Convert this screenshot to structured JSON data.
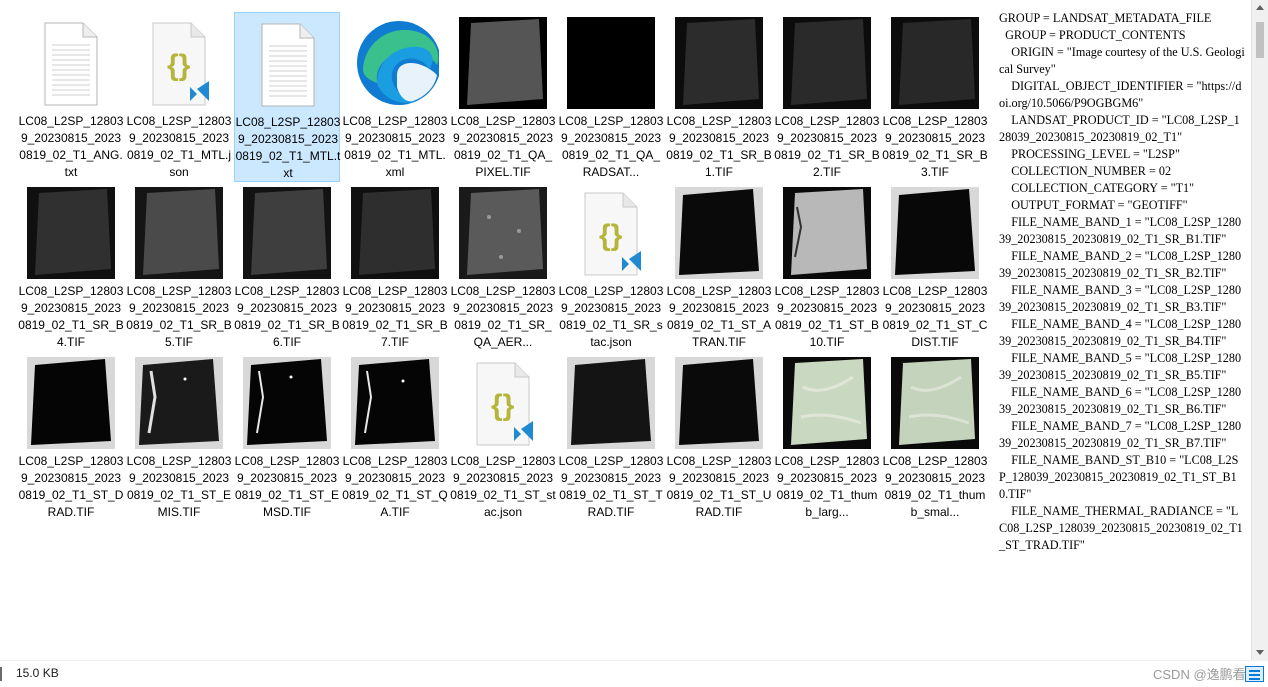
{
  "files": [
    {
      "name": "LC08_L2SP_128039_20230815_20230819_02_T1_ANG.txt",
      "icon": "text-document-icon",
      "selected": false
    },
    {
      "name": "LC08_L2SP_128039_20230815_20230819_02_T1_MTL.json",
      "icon": "json-vscode-icon",
      "selected": false
    },
    {
      "name": "LC08_L2SP_128039_20230815_20230819_02_T1_MTL.txt",
      "icon": "text-document-icon",
      "selected": true
    },
    {
      "name": "LC08_L2SP_128039_20230815_20230819_02_T1_MTL.xml",
      "icon": "edge-browser-icon",
      "selected": false
    },
    {
      "name": "LC08_L2SP_128039_20230815_20230819_02_T1_QA_PIXEL.TIF",
      "icon": "tif-thumbnail-icon",
      "selected": false
    },
    {
      "name": "LC08_L2SP_128039_20230815_20230819_02_T1_QA_RADSAT...",
      "icon": "tif-thumbnail-icon",
      "selected": false
    },
    {
      "name": "LC08_L2SP_128039_20230815_20230819_02_T1_SR_B1.TIF",
      "icon": "tif-thumbnail-icon",
      "selected": false
    },
    {
      "name": "LC08_L2SP_128039_20230815_20230819_02_T1_SR_B2.TIF",
      "icon": "tif-thumbnail-icon",
      "selected": false
    },
    {
      "name": "LC08_L2SP_128039_20230815_20230819_02_T1_SR_B3.TIF",
      "icon": "tif-thumbnail-icon",
      "selected": false
    },
    {
      "name": "LC08_L2SP_128039_20230815_20230819_02_T1_SR_B4.TIF",
      "icon": "tif-thumbnail-icon",
      "selected": false
    },
    {
      "name": "LC08_L2SP_128039_20230815_20230819_02_T1_SR_B5.TIF",
      "icon": "tif-thumbnail-icon",
      "selected": false
    },
    {
      "name": "LC08_L2SP_128039_20230815_20230819_02_T1_SR_B6.TIF",
      "icon": "tif-thumbnail-icon",
      "selected": false
    },
    {
      "name": "LC08_L2SP_128039_20230815_20230819_02_T1_SR_B7.TIF",
      "icon": "tif-thumbnail-icon",
      "selected": false
    },
    {
      "name": "LC08_L2SP_128039_20230815_20230819_02_T1_SR_QA_AER...",
      "icon": "tif-thumbnail-icon",
      "selected": false
    },
    {
      "name": "LC08_L2SP_128039_20230815_20230819_02_T1_SR_stac.json",
      "icon": "json-vscode-icon",
      "selected": false
    },
    {
      "name": "LC08_L2SP_128039_20230815_20230819_02_T1_ST_ATRAN.TIF",
      "icon": "tif-thumbnail-icon",
      "selected": false
    },
    {
      "name": "LC08_L2SP_128039_20230815_20230819_02_T1_ST_B10.TIF",
      "icon": "tif-thumbnail-icon",
      "selected": false
    },
    {
      "name": "LC08_L2SP_128039_20230815_20230819_02_T1_ST_CDIST.TIF",
      "icon": "tif-thumbnail-icon",
      "selected": false
    },
    {
      "name": "LC08_L2SP_128039_20230815_20230819_02_T1_ST_DRAD.TIF",
      "icon": "tif-thumbnail-icon",
      "selected": false
    },
    {
      "name": "LC08_L2SP_128039_20230815_20230819_02_T1_ST_EMIS.TIF",
      "icon": "tif-thumbnail-icon",
      "selected": false
    },
    {
      "name": "LC08_L2SP_128039_20230815_20230819_02_T1_ST_EMSD.TIF",
      "icon": "tif-thumbnail-icon",
      "selected": false
    },
    {
      "name": "LC08_L2SP_128039_20230815_20230819_02_T1_ST_QA.TIF",
      "icon": "tif-thumbnail-icon",
      "selected": false
    },
    {
      "name": "LC08_L2SP_128039_20230815_20230819_02_T1_ST_stac.json",
      "icon": "json-vscode-icon",
      "selected": false
    },
    {
      "name": "LC08_L2SP_128039_20230815_20230819_02_T1_ST_TRAD.TIF",
      "icon": "tif-thumbnail-icon",
      "selected": false
    },
    {
      "name": "LC08_L2SP_128039_20230815_20230819_02_T1_ST_URAD.TIF",
      "icon": "tif-thumbnail-icon",
      "selected": false
    },
    {
      "name": "LC08_L2SP_128039_20230815_20230819_02_T1_thumb_larg...",
      "icon": "jpeg-thumbnail-icon",
      "selected": false
    },
    {
      "name": "LC08_L2SP_128039_20230815_20230819_02_T1_thumb_smal...",
      "icon": "jpeg-thumbnail-icon",
      "selected": false
    }
  ],
  "preview_text": "GROUP = LANDSAT_METADATA_FILE\n  GROUP = PRODUCT_CONTENTS\n    ORIGIN = \"Image courtesy of the U.S. Geological Survey\"\n    DIGITAL_OBJECT_IDENTIFIER = \"https://doi.org/10.5066/P9OGBGM6\"\n    LANDSAT_PRODUCT_ID = \"LC08_L2SP_128039_20230815_20230819_02_T1\"\n    PROCESSING_LEVEL = \"L2SP\"\n    COLLECTION_NUMBER = 02\n    COLLECTION_CATEGORY = \"T1\"\n    OUTPUT_FORMAT = \"GEOTIFF\"\n    FILE_NAME_BAND_1 = \"LC08_L2SP_128039_20230815_20230819_02_T1_SR_B1.TIF\"\n    FILE_NAME_BAND_2 = \"LC08_L2SP_128039_20230815_20230819_02_T1_SR_B2.TIF\"\n    FILE_NAME_BAND_3 = \"LC08_L2SP_128039_20230815_20230819_02_T1_SR_B3.TIF\"\n    FILE_NAME_BAND_4 = \"LC08_L2SP_128039_20230815_20230819_02_T1_SR_B4.TIF\"\n    FILE_NAME_BAND_5 = \"LC08_L2SP_128039_20230815_20230819_02_T1_SR_B5.TIF\"\n    FILE_NAME_BAND_6 = \"LC08_L2SP_128039_20230815_20230819_02_T1_SR_B6.TIF\"\n    FILE_NAME_BAND_7 = \"LC08_L2SP_128039_20230815_20230819_02_T1_SR_B7.TIF\"\n    FILE_NAME_BAND_ST_B10 = \"LC08_L2SP_128039_20230815_20230819_02_T1_ST_B10.TIF\"\n    FILE_NAME_THERMAL_RADIANCE = \"LC08_L2SP_128039_20230815_20230819_02_T1_ST_TRAD.TIF\"",
  "status": {
    "size": "15.0 KB"
  },
  "watermark": "CSDN @逸鹏看云",
  "colors": {
    "selection_fill": "#cce8ff",
    "selection_border": "#99d1ff",
    "json_brace": "#b5b53a",
    "vscode_blue": "#1f8ad2"
  }
}
